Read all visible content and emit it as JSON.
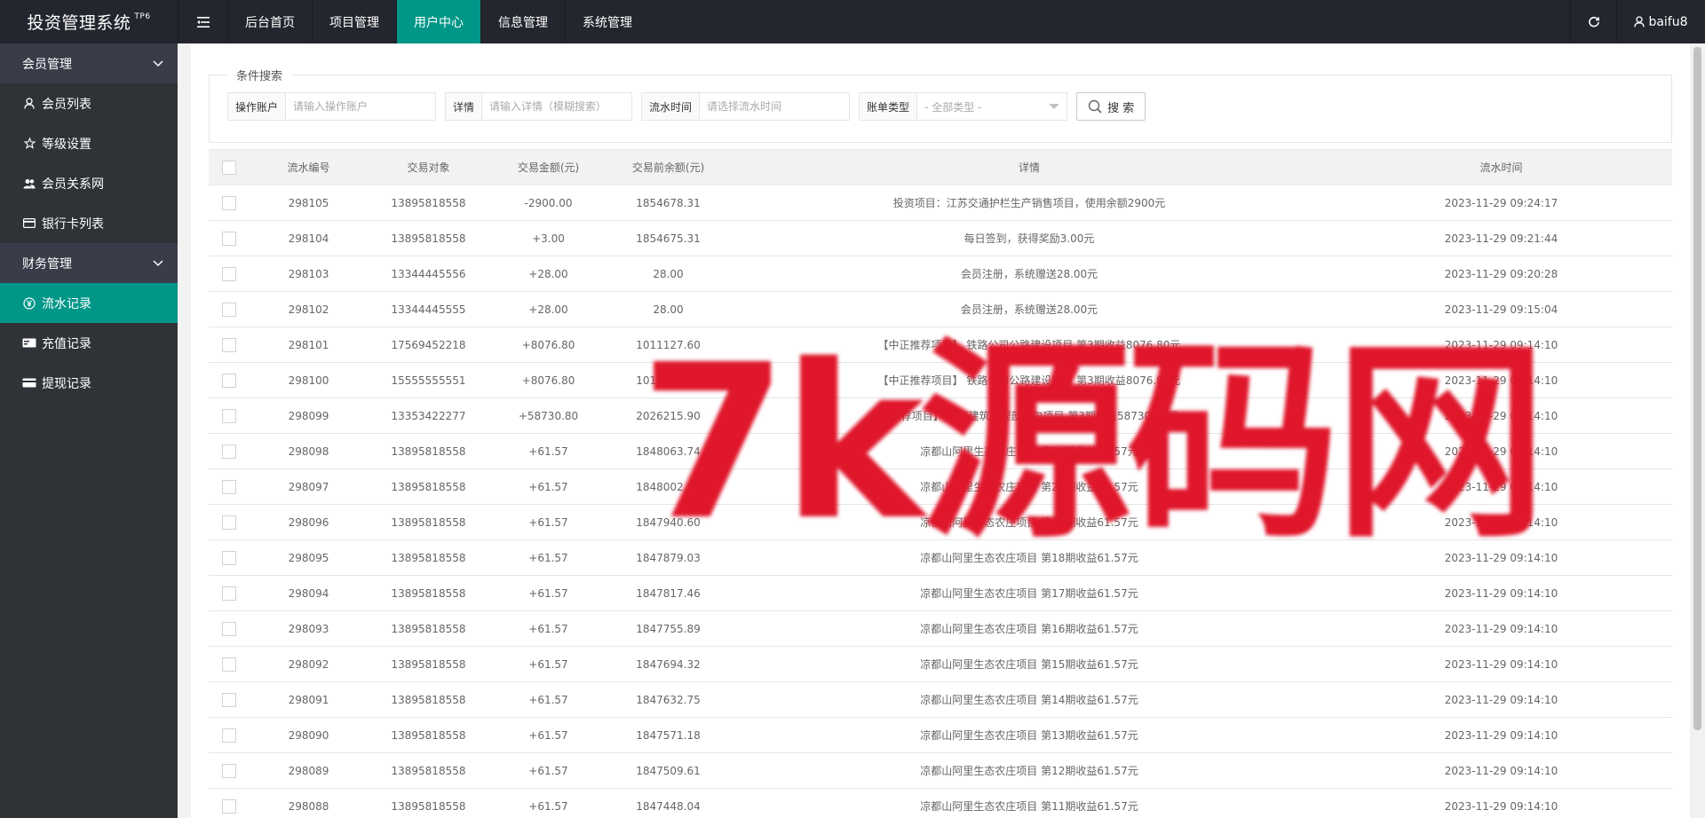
{
  "app": {
    "logo": "投资管理系统",
    "logo_badge": "TP6",
    "user": "baifu8"
  },
  "top_nav": [
    {
      "label": "后台首页",
      "active": false
    },
    {
      "label": "项目管理",
      "active": false
    },
    {
      "label": "用户中心",
      "active": true
    },
    {
      "label": "信息管理",
      "active": false
    },
    {
      "label": "系统管理",
      "active": false
    }
  ],
  "sidebar": {
    "member_group": "会员管理",
    "member_items": [
      {
        "label": "会员列表",
        "icon": "user-icon"
      },
      {
        "label": "等级设置",
        "icon": "star-icon"
      },
      {
        "label": "会员关系网",
        "icon": "users-icon"
      },
      {
        "label": "银行卡列表",
        "icon": "card-icon"
      }
    ],
    "finance_group": "财务管理",
    "finance_items": [
      {
        "label": "流水记录",
        "icon": "yen-icon",
        "active": true
      },
      {
        "label": "充值记录",
        "icon": "recharge-icon"
      },
      {
        "label": "提现记录",
        "icon": "withdraw-icon"
      }
    ]
  },
  "search": {
    "legend": "条件搜索",
    "account_label": "操作账户",
    "account_placeholder": "请输入操作账户",
    "detail_label": "详情",
    "detail_placeholder": "请输入详情（模糊搜索）",
    "time_label": "流水时间",
    "time_placeholder": "请选择流水时间",
    "type_label": "账单类型",
    "type_value": "- 全部类型 -",
    "button": "搜 索"
  },
  "table": {
    "columns": [
      "流水编号",
      "交易对象",
      "交易金额(元)",
      "交易前余额(元)",
      "详情",
      "流水时间"
    ],
    "rows": [
      {
        "id": "298105",
        "target": "13895818558",
        "amount": "-2900.00",
        "before": "1854678.31",
        "detail": "投资项目：江苏交通护栏生产销售项目，使用余额2900元",
        "time": "2023-11-29 09:24:17"
      },
      {
        "id": "298104",
        "target": "13895818558",
        "amount": "+3.00",
        "before": "1854675.31",
        "detail": "每日签到，获得奖励3.00元",
        "time": "2023-11-29 09:21:44"
      },
      {
        "id": "298103",
        "target": "13344445556",
        "amount": "+28.00",
        "before": "28.00",
        "detail": "会员注册，系统赠送28.00元",
        "time": "2023-11-29 09:20:28"
      },
      {
        "id": "298102",
        "target": "13344445555",
        "amount": "+28.00",
        "before": "28.00",
        "detail": "会员注册，系统赠送28.00元",
        "time": "2023-11-29 09:15:04"
      },
      {
        "id": "298101",
        "target": "17569452218",
        "amount": "+8076.80",
        "before": "1011127.60",
        "detail": "【中正推荐项目】 铁路公司公路建设项目 第3期收益8076.80元",
        "time": "2023-11-29 09:14:10"
      },
      {
        "id": "298100",
        "target": "15555555551",
        "amount": "+8076.80",
        "before": "1011127.60",
        "detail": "【中正推荐项目】 铁路公司公路建设项目 第3期收益8076.80元",
        "time": "2023-11-29 09:14:10"
      },
      {
        "id": "298099",
        "target": "13353422277",
        "amount": "+58730.80",
        "before": "2026215.90",
        "detail": "【推荐项目】 河南建筑工程部分包项目 第3期收益58730.80元",
        "time": "2023-11-29 09:14:10"
      },
      {
        "id": "298098",
        "target": "13895818558",
        "amount": "+61.57",
        "before": "1848063.74",
        "detail": "凉都山阿里生态农庄项目 第21期收益61.57元",
        "time": "2023-11-29 09:14:10"
      },
      {
        "id": "298097",
        "target": "13895818558",
        "amount": "+61.57",
        "before": "1848002.17",
        "detail": "凉都山阿里生态农庄项目 第20期收益61.57元",
        "time": "2023-11-29 09:14:10"
      },
      {
        "id": "298096",
        "target": "13895818558",
        "amount": "+61.57",
        "before": "1847940.60",
        "detail": "凉都山阿里生态农庄项目 第19期收益61.57元",
        "time": "2023-11-29 09:14:10"
      },
      {
        "id": "298095",
        "target": "13895818558",
        "amount": "+61.57",
        "before": "1847879.03",
        "detail": "凉都山阿里生态农庄项目 第18期收益61.57元",
        "time": "2023-11-29 09:14:10"
      },
      {
        "id": "298094",
        "target": "13895818558",
        "amount": "+61.57",
        "before": "1847817.46",
        "detail": "凉都山阿里生态农庄项目 第17期收益61.57元",
        "time": "2023-11-29 09:14:10"
      },
      {
        "id": "298093",
        "target": "13895818558",
        "amount": "+61.57",
        "before": "1847755.89",
        "detail": "凉都山阿里生态农庄项目 第16期收益61.57元",
        "time": "2023-11-29 09:14:10"
      },
      {
        "id": "298092",
        "target": "13895818558",
        "amount": "+61.57",
        "before": "1847694.32",
        "detail": "凉都山阿里生态农庄项目 第15期收益61.57元",
        "time": "2023-11-29 09:14:10"
      },
      {
        "id": "298091",
        "target": "13895818558",
        "amount": "+61.57",
        "before": "1847632.75",
        "detail": "凉都山阿里生态农庄项目 第14期收益61.57元",
        "time": "2023-11-29 09:14:10"
      },
      {
        "id": "298090",
        "target": "13895818558",
        "amount": "+61.57",
        "before": "1847571.18",
        "detail": "凉都山阿里生态农庄项目 第13期收益61.57元",
        "time": "2023-11-29 09:14:10"
      },
      {
        "id": "298089",
        "target": "13895818558",
        "amount": "+61.57",
        "before": "1847509.61",
        "detail": "凉都山阿里生态农庄项目 第12期收益61.57元",
        "time": "2023-11-29 09:14:10"
      },
      {
        "id": "298088",
        "target": "13895818558",
        "amount": "+61.57",
        "before": "1847448.04",
        "detail": "凉都山阿里生态农庄项目 第11期收益61.57元",
        "time": "2023-11-29 09:14:10"
      }
    ]
  },
  "watermark": "7k源码网",
  "colors": {
    "accent": "#009688",
    "topbar": "#23262e",
    "sidebar": "#2f3337",
    "negative": "#ff3b30",
    "positive": "#3aa73a"
  }
}
